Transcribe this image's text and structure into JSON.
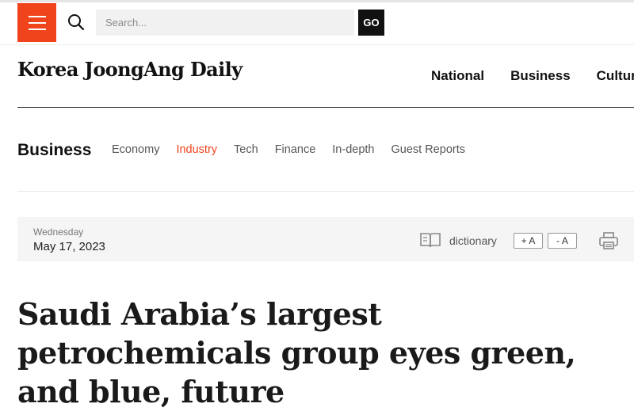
{
  "header": {
    "search": {
      "placeholder": "Search...",
      "value": ""
    },
    "go_label": "GO",
    "icons": {
      "menu": "hamburger-icon",
      "search": "search-icon"
    },
    "accent_color": "#f0441d"
  },
  "brand": {
    "logo_text": "Korea JoongAng Daily",
    "main_nav": [
      "National",
      "Business",
      "Culture"
    ]
  },
  "section": {
    "title": "Business",
    "sub_nav": [
      {
        "label": "Economy",
        "active": false
      },
      {
        "label": "Industry",
        "active": true
      },
      {
        "label": "Tech",
        "active": false
      },
      {
        "label": "Finance",
        "active": false
      },
      {
        "label": "In-depth",
        "active": false
      },
      {
        "label": "Guest Reports",
        "active": false
      }
    ]
  },
  "article_meta": {
    "weekday": "Wednesday",
    "date": "May 17, 2023",
    "dictionary_label": "dictionary",
    "font_increase_label": "+ A",
    "font_decrease_label": "- A",
    "icons": {
      "dictionary": "book-icon",
      "print": "printer-icon"
    }
  },
  "article": {
    "headline": "Saudi Arabia’s largest petrochemicals group eyes green, and blue, future"
  }
}
